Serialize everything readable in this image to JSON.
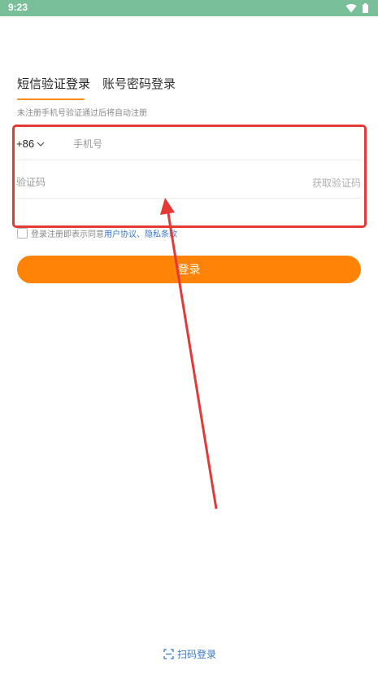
{
  "status_bar": {
    "time": "9:23"
  },
  "tabs": [
    {
      "label": "短信验证登录",
      "active": true
    },
    {
      "label": "账号密码登录",
      "active": false
    }
  ],
  "hint": "未注册手机号验证通过后将自动注册",
  "phone": {
    "country_code": "+86",
    "placeholder": "手机号",
    "value": ""
  },
  "code": {
    "placeholder": "验证码",
    "value": "",
    "get_code_label": "获取验证码"
  },
  "agreement": {
    "prefix": "登录注册即表示同意 ",
    "user_agreement": "用户协议",
    "separator": "、",
    "privacy": "隐私条款",
    "checked": false
  },
  "login_button": "登录",
  "scan_login": {
    "label": "扫码登录",
    "icon": "scan-icon"
  },
  "colors": {
    "accent": "#ff8306",
    "link": "#3a78c9",
    "status_bar": "#79bf99",
    "annotation": "#e53935"
  }
}
